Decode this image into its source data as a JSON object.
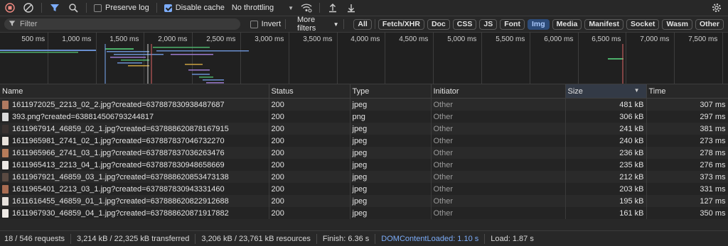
{
  "toolbar": {
    "preserve_log_label": "Preserve log",
    "disable_cache_label": "Disable cache",
    "throttling_value": "No throttling"
  },
  "filter": {
    "placeholder": "Filter",
    "invert_label": "Invert",
    "more_filters_label": "More filters",
    "types": [
      {
        "label": "All",
        "active": false
      },
      {
        "label": "Fetch/XHR",
        "active": false
      },
      {
        "label": "Doc",
        "active": false
      },
      {
        "label": "CSS",
        "active": false
      },
      {
        "label": "JS",
        "active": false
      },
      {
        "label": "Font",
        "active": false
      },
      {
        "label": "Img",
        "active": true
      },
      {
        "label": "Media",
        "active": false
      },
      {
        "label": "Manifest",
        "active": false
      },
      {
        "label": "Socket",
        "active": false
      },
      {
        "label": "Wasm",
        "active": false
      },
      {
        "label": "Other",
        "active": false
      }
    ]
  },
  "overview": {
    "ticks": [
      "500 ms",
      "1,000 ms",
      "1,500 ms",
      "2,000 ms",
      "2,500 ms",
      "3,000 ms",
      "3,500 ms",
      "4,000 ms",
      "4,500 ms",
      "5,000 ms",
      "5,500 ms",
      "6,000 ms",
      "6,500 ms",
      "7,000 ms",
      "7,500 ms"
    ]
  },
  "table": {
    "columns": [
      "Name",
      "Status",
      "Type",
      "Initiator",
      "Size",
      "Time"
    ],
    "rows": [
      {
        "name": "1611972025_2213_02_2.jpg?created=637887830938487687",
        "status": "200",
        "type": "jpeg",
        "initiator": "Other",
        "size": "481 kB",
        "time": "307 ms",
        "thumb": "#b07a60"
      },
      {
        "name": "393.png?created=638814506793244817",
        "status": "200",
        "type": "png",
        "initiator": "Other",
        "size": "306 kB",
        "time": "297 ms",
        "thumb": "#d9d9d9"
      },
      {
        "name": "1611967914_46859_02_1.jpg?created=637888620878167915",
        "status": "200",
        "type": "jpeg",
        "initiator": "Other",
        "size": "241 kB",
        "time": "381 ms",
        "thumb": "#3a3230"
      },
      {
        "name": "1611965981_2741_02_1.jpg?created=637887837046732270",
        "status": "200",
        "type": "jpeg",
        "initiator": "Other",
        "size": "240 kB",
        "time": "273 ms",
        "thumb": "#e8e2dc"
      },
      {
        "name": "1611965966_2741_03_1.jpg?created=637887837036263476",
        "status": "200",
        "type": "jpeg",
        "initiator": "Other",
        "size": "236 kB",
        "time": "278 ms",
        "thumb": "#b57b5a"
      },
      {
        "name": "1611965413_2213_04_1.jpg?created=637887830948658669",
        "status": "200",
        "type": "jpeg",
        "initiator": "Other",
        "size": "235 kB",
        "time": "276 ms",
        "thumb": "#ece8e4"
      },
      {
        "name": "1611967921_46859_03_1.jpg?created=637888620853473138",
        "status": "200",
        "type": "jpeg",
        "initiator": "Other",
        "size": "212 kB",
        "time": "373 ms",
        "thumb": "#5a4a42"
      },
      {
        "name": "1611965401_2213_03_1.jpg?created=637887830943331460",
        "status": "200",
        "type": "jpeg",
        "initiator": "Other",
        "size": "203 kB",
        "time": "331 ms",
        "thumb": "#a86c52"
      },
      {
        "name": "1611616455_46859_01_1.jpg?created=637888620822912688",
        "status": "200",
        "type": "jpeg",
        "initiator": "Other",
        "size": "195 kB",
        "time": "127 ms",
        "thumb": "#e6e1dc"
      },
      {
        "name": "1611967930_46859_04_1.jpg?created=637888620871917882",
        "status": "200",
        "type": "jpeg",
        "initiator": "Other",
        "size": "161 kB",
        "time": "350 ms",
        "thumb": "#efeae6"
      }
    ]
  },
  "status": {
    "requests": "18 / 546 requests",
    "transferred": "3,214 kB / 22,325 kB transferred",
    "resources": "3,206 kB / 23,761 kB resources",
    "finish": "Finish: 6.36 s",
    "dcl": "DOMContentLoaded: 1.10 s",
    "load": "Load: 1.87 s"
  },
  "colors": {
    "accent": "#7cacf8",
    "record": "#f28b82",
    "active_chip": "#2d4b78"
  }
}
